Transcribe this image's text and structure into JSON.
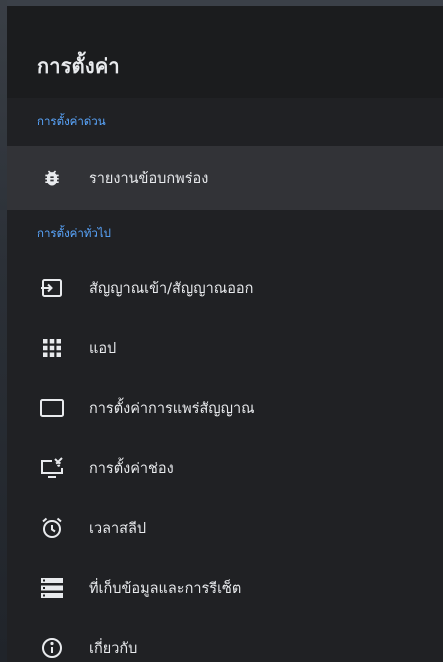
{
  "header": {
    "title": "การตั้งค่า"
  },
  "sections": {
    "quick": {
      "label": "การตั้งค่าด่วน",
      "items": [
        {
          "label": "รายงานข้อบกพร่อง",
          "icon": "bug-icon"
        }
      ]
    },
    "general": {
      "label": "การตั้งค่าทั่วไป",
      "items": [
        {
          "label": "สัญญาณเข้า/สัญญาณออก",
          "icon": "input-icon"
        },
        {
          "label": "แอป",
          "icon": "apps-grid-icon"
        },
        {
          "label": "การตั้งค่าการแพร่สัญญาณ",
          "icon": "tv-screen-icon"
        },
        {
          "label": "การตั้งค่าช่อง",
          "icon": "tv-channel-icon"
        },
        {
          "label": "เวลาสลีป",
          "icon": "alarm-clock-icon"
        },
        {
          "label": "ที่เก็บข้อมูลและการรีเซ็ต",
          "icon": "storage-icon"
        },
        {
          "label": "เกี่ยวกับ",
          "icon": "info-icon"
        }
      ]
    }
  },
  "colors": {
    "background": "#202124",
    "header_background": "#1b1c1e",
    "highlight": "#323337",
    "section_label": "#5aa7ff",
    "text": "#e8eaed"
  }
}
